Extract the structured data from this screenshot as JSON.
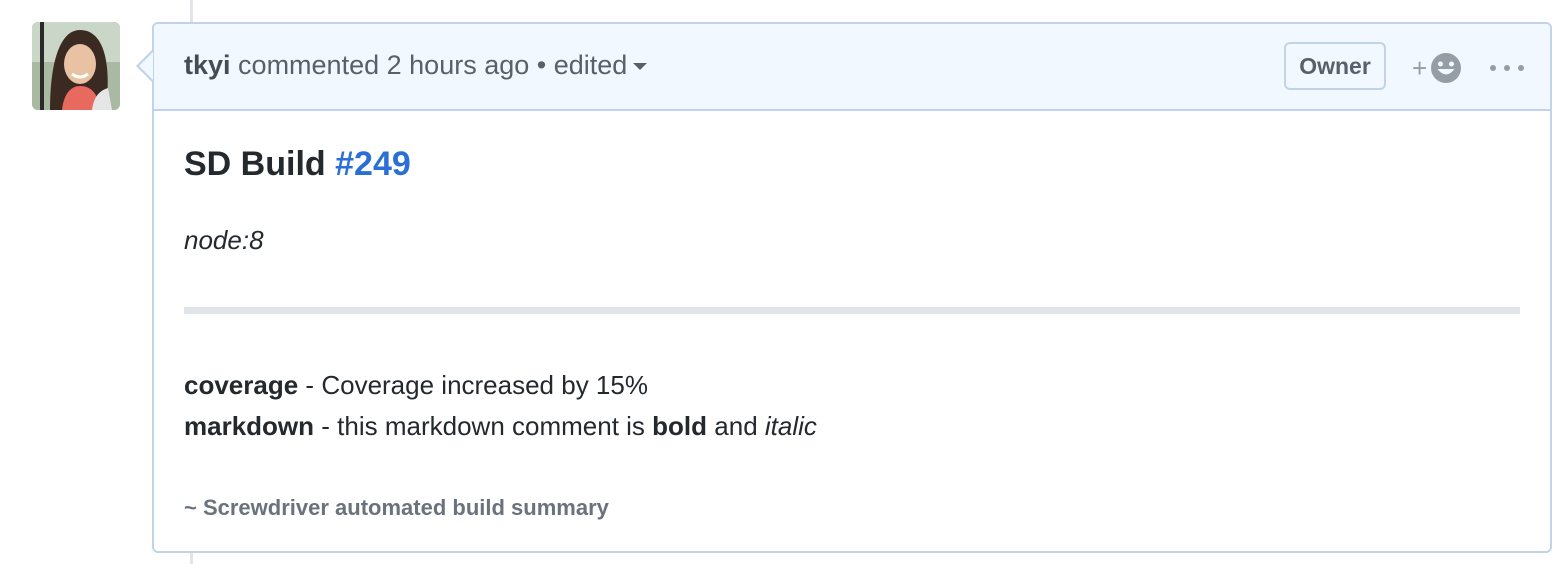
{
  "comment": {
    "author": "tkyi",
    "action": "commented",
    "time": "2 hours ago",
    "separator": "•",
    "edited_label": "edited",
    "role_badge": "Owner",
    "reaction_plus": "+",
    "title_prefix": "SD Build",
    "build_link": "#249",
    "node": "node:8",
    "rows": [
      {
        "key": "coverage",
        "dash": "-",
        "text": "Coverage increased by 15%"
      },
      {
        "key": "markdown",
        "dash": "-",
        "text_before": "this markdown comment is",
        "bold": "bold",
        "mid": "and",
        "italic": "italic"
      }
    ],
    "footer": "~ Screwdriver automated build summary"
  },
  "colors": {
    "header_bg": "#f1f8ff",
    "border": "#c0d3eb",
    "link": "#2a6ed6",
    "muted": "#586069"
  }
}
